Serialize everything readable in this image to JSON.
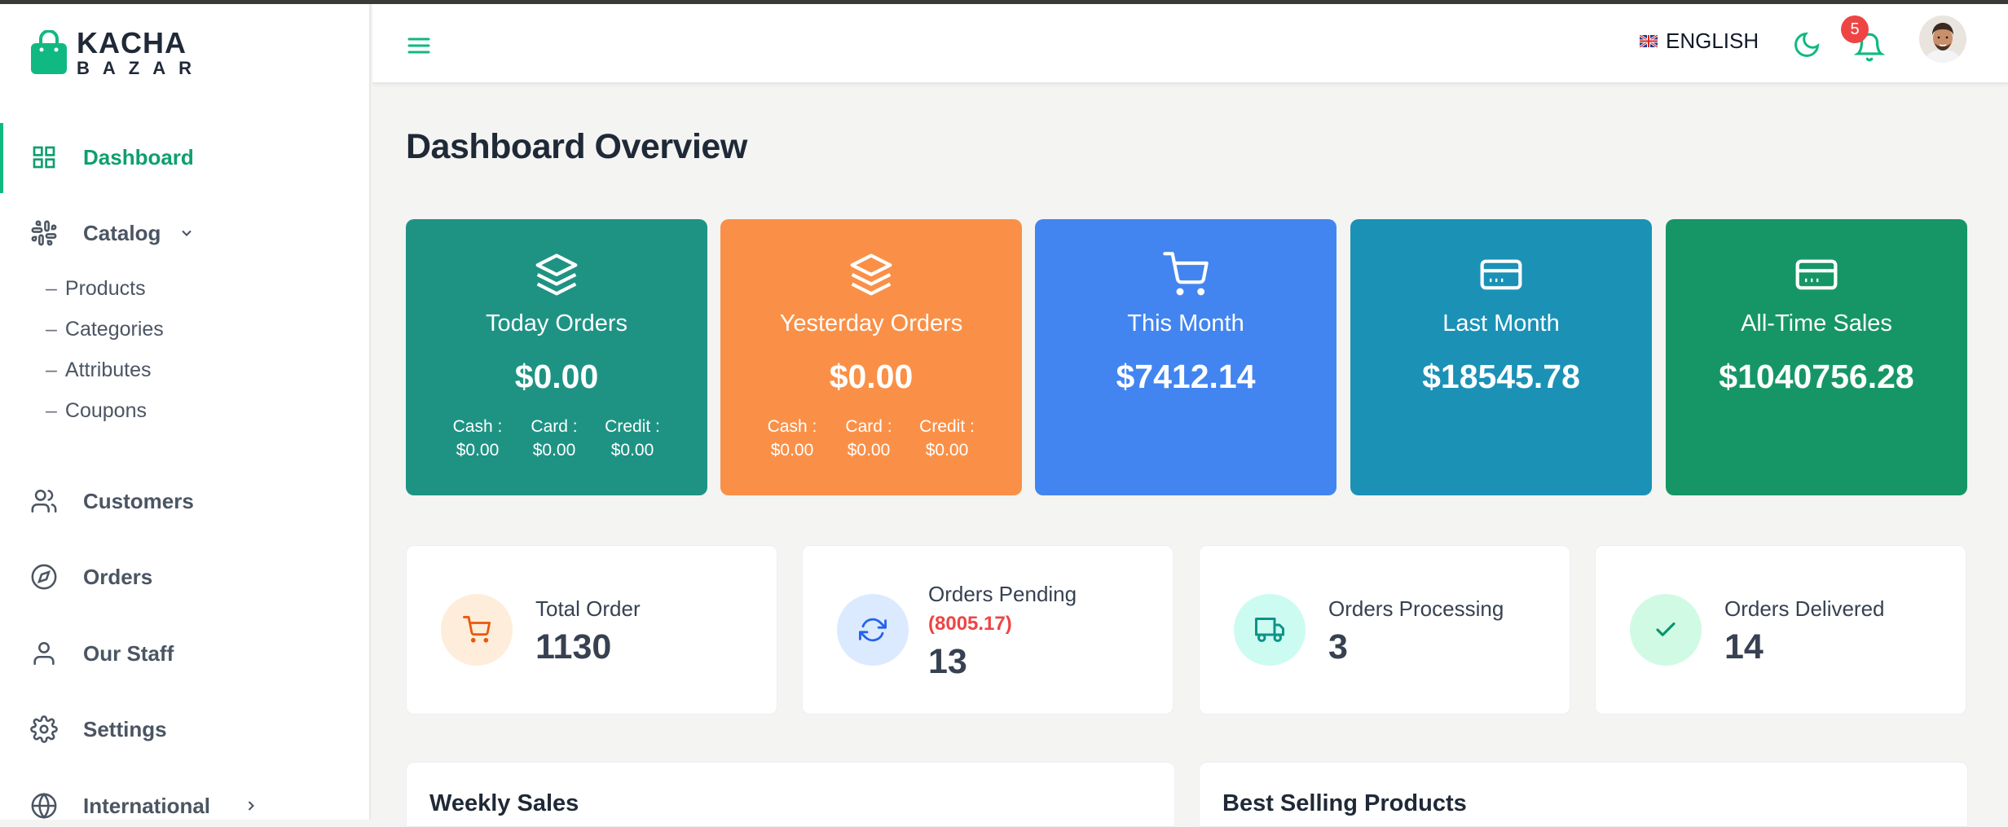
{
  "brand": {
    "name_top": "KACHA",
    "name_bottom": "BAZAR",
    "accent_color": "#10b981"
  },
  "sidebar": {
    "items": [
      {
        "label": "Dashboard",
        "icon": "grid-icon",
        "active": true
      },
      {
        "label": "Catalog",
        "icon": "slack-icon",
        "expanded": true
      },
      {
        "label": "Customers",
        "icon": "users-icon"
      },
      {
        "label": "Orders",
        "icon": "compass-icon"
      },
      {
        "label": "Our Staff",
        "icon": "user-icon"
      },
      {
        "label": "Settings",
        "icon": "gear-icon"
      },
      {
        "label": "International",
        "icon": "globe-icon"
      }
    ],
    "catalog_sub": [
      {
        "dash": "–",
        "label": "Products"
      },
      {
        "dash": "–",
        "label": "Categories"
      },
      {
        "dash": "–",
        "label": "Attributes"
      },
      {
        "dash": "–",
        "label": "Coupons"
      }
    ]
  },
  "header": {
    "language": "ENGLISH",
    "notification_count": "5"
  },
  "page": {
    "title": "Dashboard Overview"
  },
  "stat_cards": [
    {
      "title": "Today Orders",
      "value": "$0.00",
      "color": "#1e9384",
      "icon": "layers-icon",
      "breakdown": [
        {
          "label": "Cash :",
          "value": "$0.00"
        },
        {
          "label": "Card :",
          "value": "$0.00"
        },
        {
          "label": "Credit :",
          "value": "$0.00"
        }
      ]
    },
    {
      "title": "Yesterday Orders",
      "value": "$0.00",
      "color": "#fa9047",
      "icon": "layers-icon",
      "breakdown": [
        {
          "label": "Cash :",
          "value": "$0.00"
        },
        {
          "label": "Card :",
          "value": "$0.00"
        },
        {
          "label": "Credit :",
          "value": "$0.00"
        }
      ]
    },
    {
      "title": "This Month",
      "value": "$7412.14",
      "color": "#4285f1",
      "icon": "cart-icon"
    },
    {
      "title": "Last Month",
      "value": "$18545.78",
      "color": "#1b91b6",
      "icon": "credit-card-icon"
    },
    {
      "title": "All-Time Sales",
      "value": "$1040756.28",
      "color": "#169667",
      "icon": "credit-card-icon"
    }
  ],
  "mini_cards": [
    {
      "label": "Total Order",
      "value": "1130",
      "icon": "cart-icon",
      "circle_bg": "#feedda",
      "icon_color": "#ea580c"
    },
    {
      "label": "Orders Pending",
      "extra": "(8005.17)",
      "value": "13",
      "icon": "refresh-icon",
      "circle_bg": "#dbeafe",
      "icon_color": "#2563eb"
    },
    {
      "label": "Orders Processing",
      "value": "3",
      "icon": "truck-icon",
      "circle_bg": "#ccfbf1",
      "icon_color": "#0d9488"
    },
    {
      "label": "Orders Delivered",
      "value": "14",
      "icon": "check-icon",
      "circle_bg": "#d1fae5",
      "icon_color": "#059669"
    }
  ],
  "panels": [
    {
      "title": "Weekly Sales"
    },
    {
      "title": "Best Selling Products"
    }
  ]
}
